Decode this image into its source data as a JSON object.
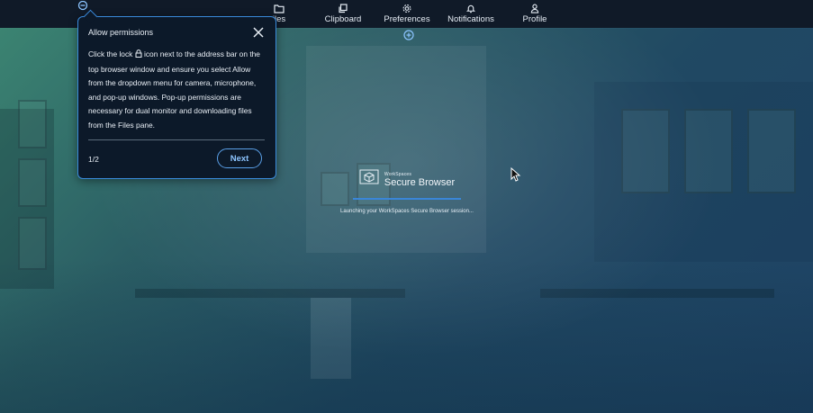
{
  "toolbar": {
    "items": [
      {
        "label": "Files",
        "shown_text": "iles",
        "icon": "folder-icon"
      },
      {
        "label": "Clipboard",
        "icon": "clipboard-icon"
      },
      {
        "label": "Preferences",
        "icon": "gear-icon"
      },
      {
        "label": "Notifications",
        "icon": "bell-icon"
      },
      {
        "label": "Profile",
        "icon": "person-icon"
      }
    ]
  },
  "popover": {
    "title": "Allow permissions",
    "body_before_icon": "Click the lock ",
    "body_after_icon": " icon next to the address bar on the top browser window and ensure you select Allow from the dropdown menu for camera, microphone, and pop-up windows. Pop-up permissions are necessary for dual monitor and downloading files from the Files pane.",
    "step": "1/2",
    "next_label": "Next"
  },
  "launch": {
    "brand_small": "WorkSpaces",
    "brand_big": "Secure Browser",
    "message": "Launching your WorkSpaces Secure Browser session...",
    "progress": 1.0
  },
  "colors": {
    "accent": "#3a8bdc",
    "toolbar_bg": "#101a28",
    "popover_bg": "#0c1929"
  }
}
